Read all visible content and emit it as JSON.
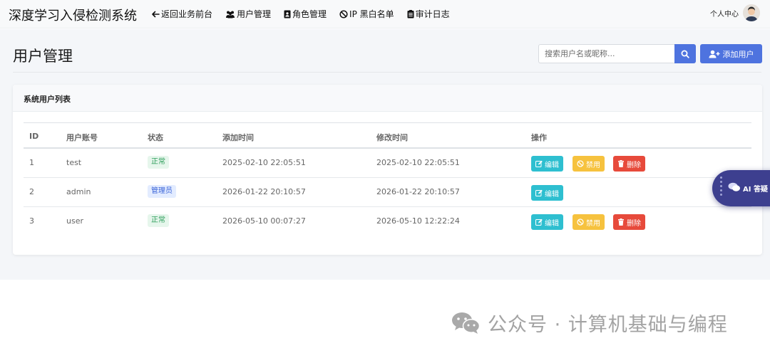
{
  "app": {
    "brand": "深度学习入侵检测系统",
    "nav": [
      {
        "label": "返回业务前台",
        "icon": "arrow-left-icon"
      },
      {
        "label": "用户管理",
        "icon": "users-icon"
      },
      {
        "label": "角色管理",
        "icon": "id-badge-icon"
      },
      {
        "label": "IP 黑白名单",
        "icon": "ban-icon"
      },
      {
        "label": "审计日志",
        "icon": "clipboard-list-icon"
      }
    ],
    "user_center": "个人中心"
  },
  "page": {
    "title": "用户管理",
    "search_placeholder": "搜索用户名或昵称...",
    "add_user_label": "添加用户"
  },
  "card": {
    "title": "系统用户列表",
    "columns": [
      "ID",
      "用户账号",
      "状态",
      "添加时间",
      "修改时间",
      "操作"
    ],
    "rows": [
      {
        "id": "1",
        "username": "test",
        "status": "正常",
        "status_type": "normal",
        "created": "2025-02-10 22:05:51",
        "updated": "2025-02-10 22:05:51",
        "actions": [
          "编辑",
          "禁用",
          "删除"
        ]
      },
      {
        "id": "2",
        "username": "admin",
        "status": "管理员",
        "status_type": "admin",
        "created": "2026-01-22 20:10:57",
        "updated": "2026-01-22 20:10:57",
        "actions": [
          "编辑"
        ]
      },
      {
        "id": "3",
        "username": "user",
        "status": "正常",
        "status_type": "normal",
        "created": "2026-05-10 00:07:27",
        "updated": "2026-05-10 12:22:24",
        "actions": [
          "编辑",
          "禁用",
          "删除"
        ]
      }
    ]
  },
  "ai_assistant": {
    "label": "AI 答疑"
  },
  "watermark": {
    "text": "公众号 · 计算机基础与编程"
  },
  "colors": {
    "primary": "#4e73df",
    "edit": "#2ebfd0",
    "disable": "#f6c23e",
    "delete": "#e74a3b",
    "normal_badge": "#2e9e5b",
    "admin_badge": "#3a64d8"
  }
}
